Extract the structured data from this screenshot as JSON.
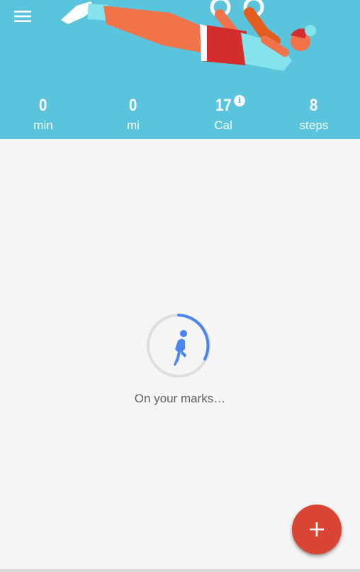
{
  "app": {
    "accent": "#5ac4dc",
    "fab_color": "#d94433"
  },
  "header": {
    "menu_icon": "hamburger-menu-icon",
    "stats": [
      {
        "value": "0",
        "unit": "min"
      },
      {
        "value": "0",
        "unit": "mi"
      },
      {
        "value": "17",
        "unit": "Cal",
        "info_icon": "info-icon"
      },
      {
        "value": "8",
        "unit": "steps"
      }
    ]
  },
  "main": {
    "loading_text": "On your marks…",
    "loading_icon": "runner-icon"
  },
  "fab": {
    "icon": "plus-icon"
  }
}
